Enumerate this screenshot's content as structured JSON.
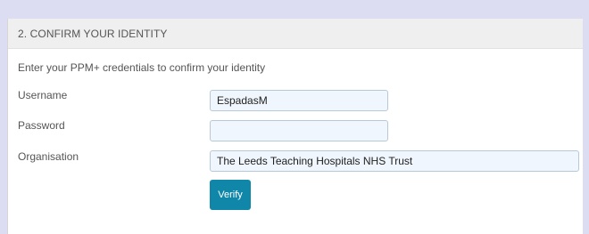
{
  "section": {
    "title": "2. CONFIRM YOUR IDENTITY",
    "intro": "Enter your PPM+ credentials to confirm your identity"
  },
  "form": {
    "username": {
      "label": "Username",
      "value": "EspadasM"
    },
    "password": {
      "label": "Password",
      "value": ""
    },
    "organisation": {
      "label": "Organisation",
      "value": "The Leeds Teaching Hospitals NHS Trust"
    },
    "verify_label": "Verify"
  },
  "colors": {
    "page_background": "#dcdcf3",
    "header_background": "#efefef",
    "input_background": "#f0f6fd",
    "button_background": "#1087a9"
  }
}
